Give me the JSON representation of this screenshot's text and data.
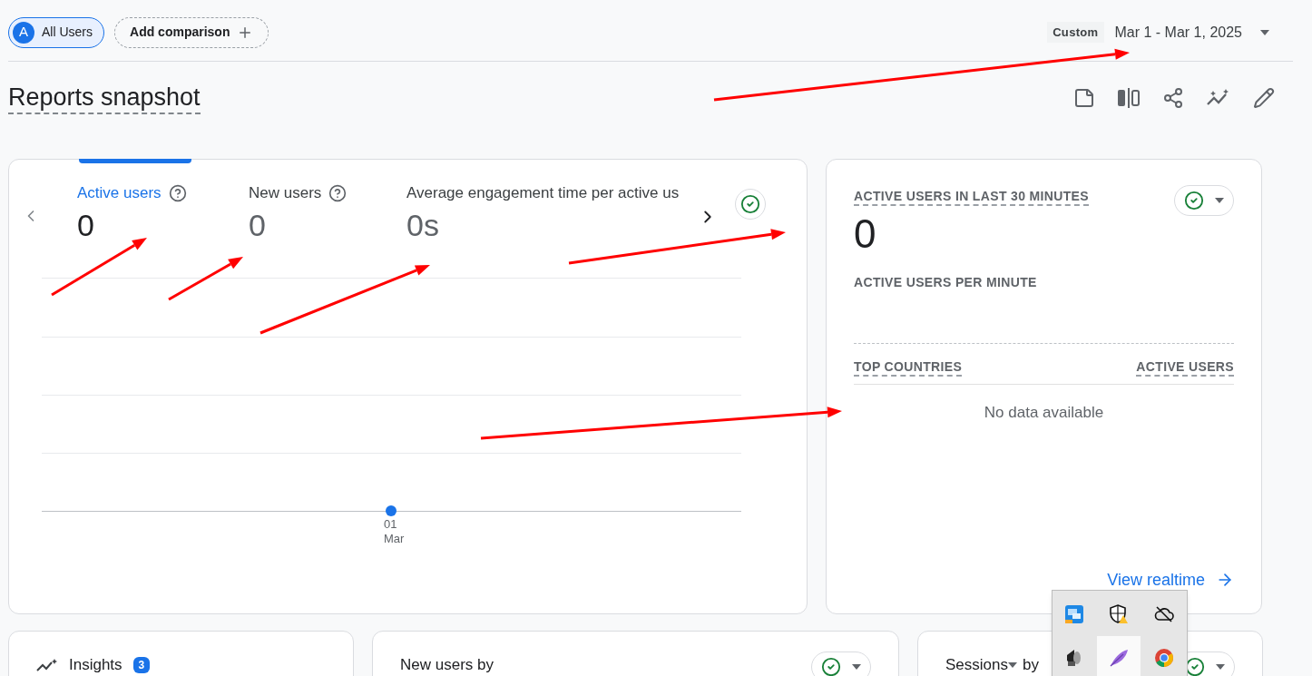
{
  "segments": [
    {
      "avatar": "A",
      "label": "All Users",
      "selected": true
    }
  ],
  "add_comparison": "Add comparison",
  "date_range": {
    "badge": "Custom",
    "range": "Mar 1 - Mar 1, 2025"
  },
  "title": "Reports snapshot",
  "metrics": [
    {
      "label": "Active users",
      "value": "0",
      "selected": true,
      "help": true
    },
    {
      "label": "New users",
      "value": "0",
      "selected": false,
      "help": true
    },
    {
      "label": "Average engagement time per active us",
      "value": "0s",
      "selected": false,
      "help": false
    }
  ],
  "chart": {
    "x_day": "01",
    "x_month": "Mar"
  },
  "realtime": {
    "title": "ACTIVE USERS IN LAST 30 MINUTES",
    "value": "0",
    "per_minute": "ACTIVE USERS PER MINUTE",
    "columns": [
      "TOP COUNTRIES",
      "ACTIVE USERS"
    ],
    "empty": "No data available",
    "link": "View realtime"
  },
  "cards": [
    {
      "kind": "insights",
      "title": "Insights",
      "badge": "3"
    },
    {
      "kind": "plain",
      "title": "New users by"
    },
    {
      "kind": "dropdown",
      "title": "Sessions",
      "suffix": "by"
    }
  ],
  "tray_icons": [
    {
      "kind": "network",
      "selected": false
    },
    {
      "kind": "shield",
      "selected": false
    },
    {
      "kind": "cloud",
      "selected": false
    },
    {
      "kind": "speaker",
      "selected": false
    },
    {
      "kind": "feather",
      "selected": true
    },
    {
      "kind": "browser",
      "selected": false
    }
  ]
}
